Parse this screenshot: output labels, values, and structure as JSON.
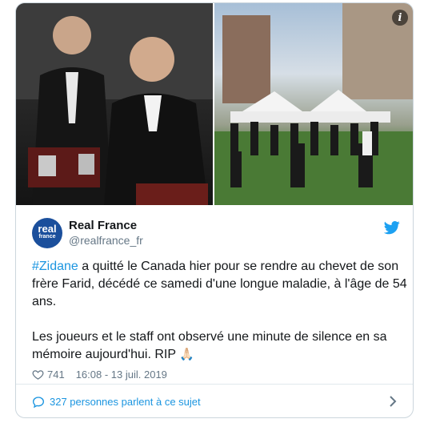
{
  "tweet": {
    "author_name": "Real France",
    "author_handle": "@realfrance_fr",
    "avatar_line1": "real",
    "avatar_line2": "france",
    "hashtag": "#Zidane",
    "paragraph1_rest": " a quitté le Canada hier pour se rendre au chevet de son frère Farid, décédé ce samedi d'une longue maladie, à l'âge de 54 ans.",
    "paragraph2": "Les joueurs et le staff ont observé une minute de silence en sa mémoire aujourd'hui. RIP ",
    "emoji": "🙏🏻",
    "likes": "741",
    "timestamp": "16:08 - 13 juil. 2019"
  },
  "conversation": {
    "label": "327 personnes parlent à ce sujet"
  },
  "colors": {
    "accent": "#1b95e0",
    "muted": "#657786",
    "border": "#ccd6dd"
  },
  "icons": [
    "info-icon",
    "twitter-bird-icon",
    "heart-icon",
    "speech-bubble-icon",
    "chevron-right-icon"
  ]
}
